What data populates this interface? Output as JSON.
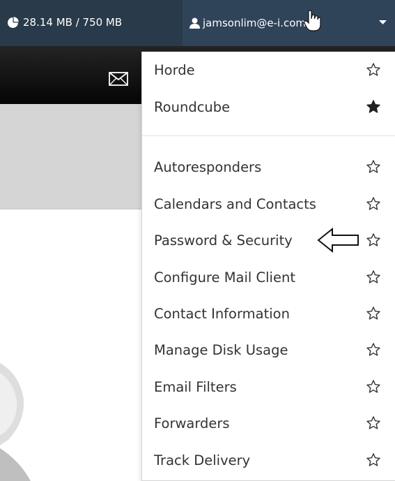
{
  "topbar": {
    "disk_usage": "28.14 MB / 750 MB",
    "disk_icon": "pie-chart-icon",
    "user_icon": "user-icon",
    "user_email": "jamsonlim@e-i.com.sg",
    "caret_icon": "caret-down-icon",
    "background": "#293a4a"
  },
  "toolbar": {
    "icon": "envelope-icon"
  },
  "menu": {
    "webmail": [
      {
        "label": "Horde",
        "favorite": false
      },
      {
        "label": "Roundcube",
        "favorite": true
      }
    ],
    "tools": [
      {
        "label": "Autoresponders",
        "favorite": false
      },
      {
        "label": "Calendars and Contacts",
        "favorite": false
      },
      {
        "label": "Password & Security",
        "favorite": false,
        "highlighted_by_arrow": true
      },
      {
        "label": "Configure Mail Client",
        "favorite": false
      },
      {
        "label": "Contact Information",
        "favorite": false
      },
      {
        "label": "Manage Disk Usage",
        "favorite": false
      },
      {
        "label": "Email Filters",
        "favorite": false
      },
      {
        "label": "Forwarders",
        "favorite": false
      },
      {
        "label": "Track Delivery",
        "favorite": false
      }
    ]
  }
}
